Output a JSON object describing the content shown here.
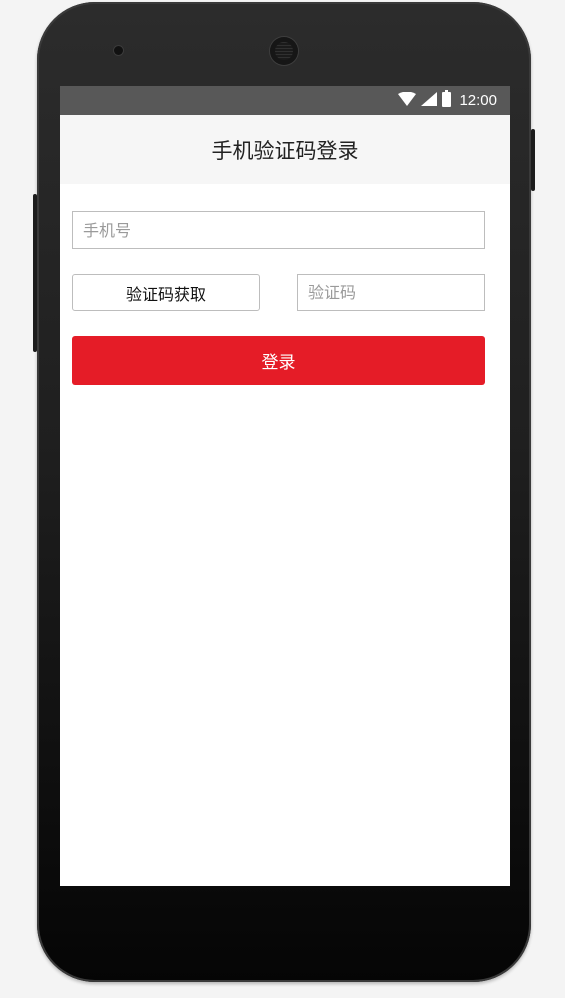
{
  "status_bar": {
    "time": "12:00",
    "icons": [
      "wifi-icon",
      "signal-icon",
      "battery-icon"
    ],
    "background": "#585858"
  },
  "header": {
    "title": "手机验证码登录"
  },
  "form": {
    "phone_placeholder": "手机号",
    "get_code_label": "验证码获取",
    "code_placeholder": "验证码",
    "login_label": "登录"
  },
  "colors": {
    "accent": "#e51c27",
    "header_background": "#f6f6f6"
  }
}
